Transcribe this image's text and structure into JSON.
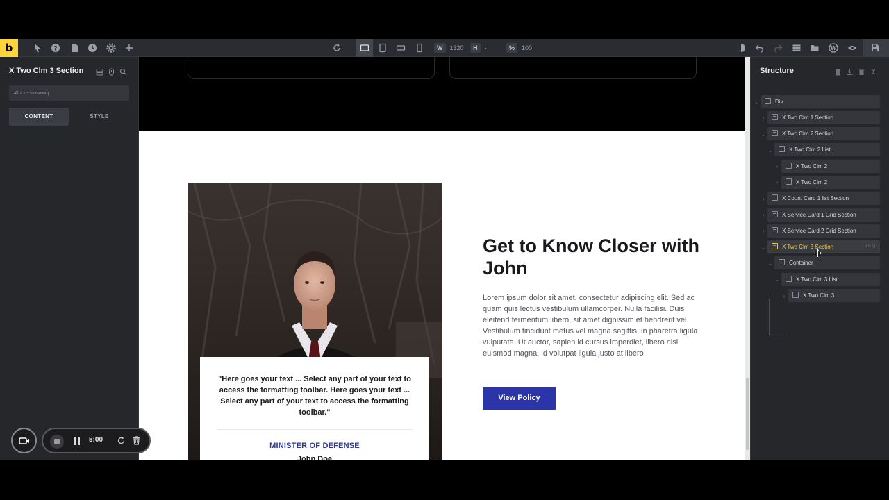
{
  "toolbar": {
    "logo": "b",
    "width_label": "W",
    "width_value": "1320",
    "height_label": "H",
    "height_value": "-",
    "zoom_label": "%",
    "zoom_value": "100"
  },
  "left_panel": {
    "title": "X Two Clm 3 Section",
    "element_id": "#brxe-mmvmwq",
    "tabs": [
      "CONTENT",
      "STYLE"
    ]
  },
  "canvas": {
    "quote": "\"Here goes your text ... Select any part of your text to access the formatting toolbar. Here goes your text ... Select any part of your text to access the formatting toolbar.\"",
    "role": "MINISTER OF DEFENSE",
    "name": "John Doe",
    "heading": "Get to Know Closer with John",
    "paragraph": "Lorem ipsum dolor sit amet, consectetur adipiscing elit. Sed ac quam quis lectus vestibulum ullamcorper. Nulla facilisi. Duis eleifend fermentum libero, sit amet dignissim et hendrerit vel. Vestibulum tincidunt metus vel magna sagittis, in pharetra ligula vulputate. Ut auctor, sapien id cursus imperdiet, libero nisi euismod magna, id volutpat ligula justo at libero",
    "button": "View Policy"
  },
  "structure": {
    "title": "Structure",
    "items": [
      {
        "label": "Div"
      },
      {
        "label": "X Two Clm 1 Section"
      },
      {
        "label": "X Two Clm 2 Section"
      },
      {
        "label": "X Two Clm 2 List"
      },
      {
        "label": "X Two Clm 2"
      },
      {
        "label": "X Two Clm 2"
      },
      {
        "label": "X Count Card 1 list Section"
      },
      {
        "label": "X Service Card 1 Grid Section"
      },
      {
        "label": "X Service Card 2 Grid Section"
      },
      {
        "label": "X Two Clm 3 Section"
      },
      {
        "label": "Container"
      },
      {
        "label": "X Two Clm 3 List"
      },
      {
        "label": "X Two Clm 3"
      }
    ],
    "selected_actions": "REM"
  },
  "recorder": {
    "time": "5:00"
  },
  "colors": {
    "accent": "#ffd53e",
    "button": "#2c35a8",
    "role_text": "#2d3494",
    "selected_text": "#f0c84a"
  }
}
